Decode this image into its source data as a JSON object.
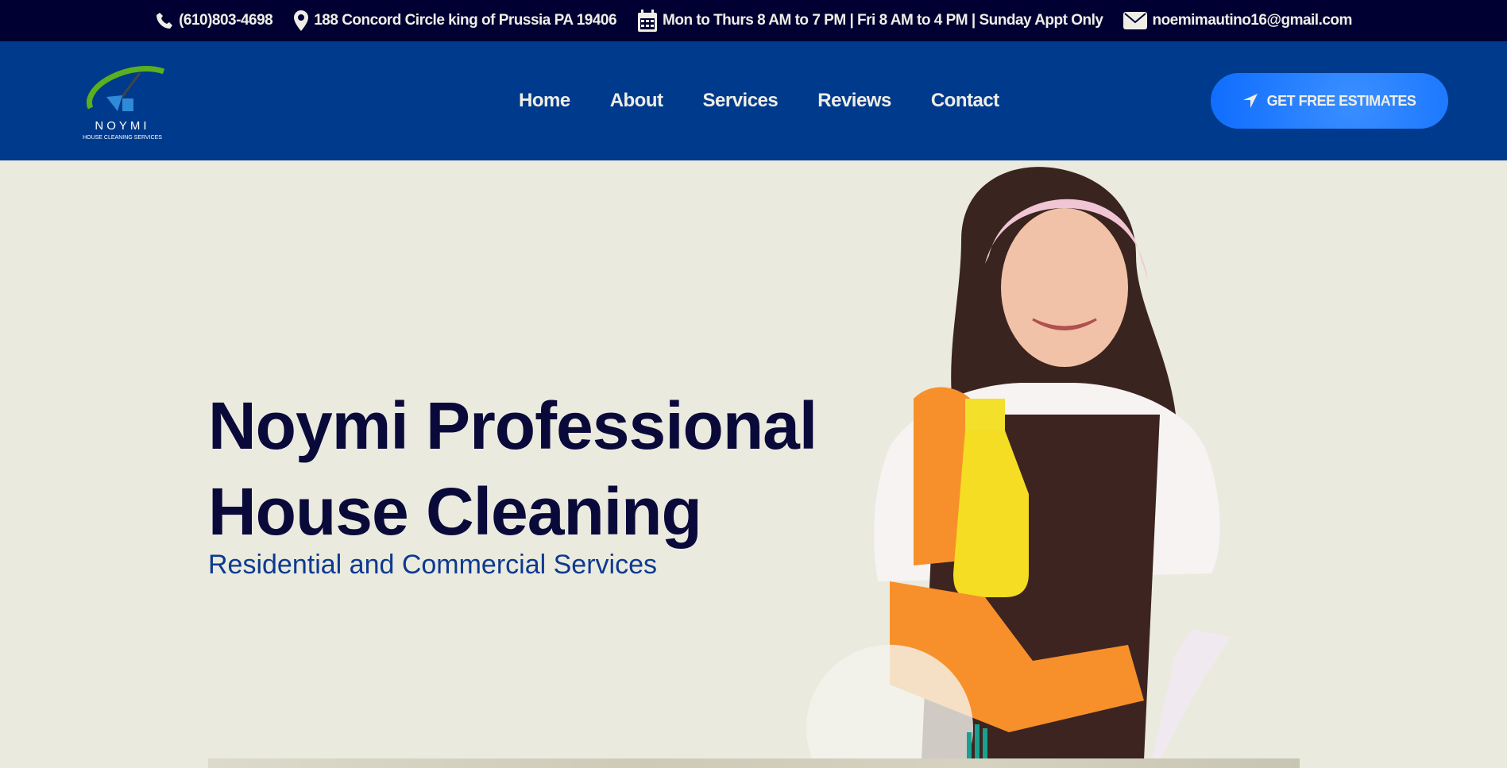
{
  "topbar": {
    "phone": "(610)803-4698",
    "address": "188 Concord Circle king of Prussia PA 19406",
    "hours": "Mon to Thurs  8 AM to 7 PM | Fri 8 AM to 4 PM | Sunday Appt Only",
    "email": "noemimautino16@gmail.com"
  },
  "logo": {
    "name": "NOYMI",
    "tagline": "HOUSE CLEANING SERVICES"
  },
  "nav": {
    "items": [
      "Home",
      "About",
      "Services",
      "Reviews",
      "Contact"
    ],
    "cta": "GET FREE ESTIMATES"
  },
  "hero": {
    "title_line1": "Noymi Professional",
    "title_line2": "House Cleaning",
    "subtitle": "Residential and Commercial Services"
  },
  "colors": {
    "topbar": "#000033",
    "nav": "#003a8c",
    "cta": "#1a75ff",
    "background": "#eaeadf"
  }
}
